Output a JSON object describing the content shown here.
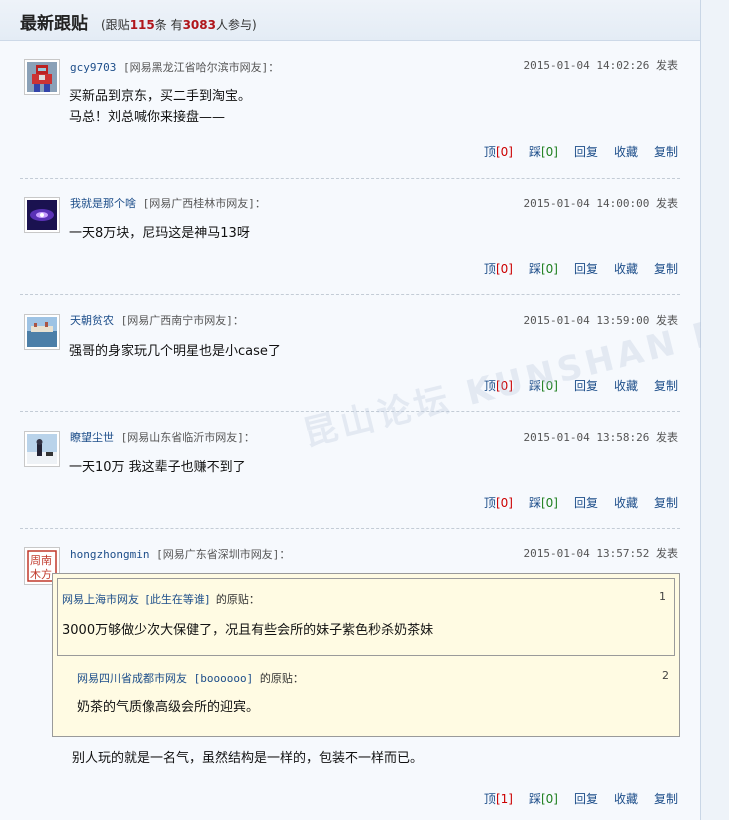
{
  "header": {
    "title": "最新跟贴",
    "stats_prefix": "(跟贴",
    "post_count": "115",
    "stats_mid": "条  有",
    "participants": "3083",
    "stats_suffix": "人参与)"
  },
  "watermark": "昆山论坛 KUNSHAN BBS",
  "posts": [
    {
      "user": "gcy9703",
      "location": "[网易黑龙江省哈尔滨市网友]：",
      "time": "2015-01-04 14:02:26 发表",
      "lines": [
        "买新品到京东，买二手到淘宝。",
        "马总！刘总喊你来接盘——"
      ],
      "avatar": "robot-avatar"
    },
    {
      "user": "我就是那个啥",
      "location": "[网易广西桂林市网友]：",
      "time": "2015-01-04 14:00:00 发表",
      "lines": [
        "一天8万块，尼玛这是神马13呀"
      ],
      "avatar": "galaxy-avatar"
    },
    {
      "user": "天朝贫农",
      "location": "[网易广西南宁市网友]：",
      "time": "2015-01-04 13:59:00 发表",
      "lines": [
        "强哥的身家玩几个明星也是小case了"
      ],
      "avatar": "harbor-avatar"
    },
    {
      "user": "瞭望尘世",
      "location": "[网易山东省临沂市网友]：",
      "time": "2015-01-04 13:58:26 发表",
      "lines": [
        "一天10万  我这辈子也赚不到了"
      ],
      "avatar": "snow-avatar"
    },
    {
      "user": "hongzhongmin",
      "location": "[网易广东省深圳市网友]：",
      "time": "2015-01-04 13:57:52 发表",
      "lines": [
        "别人玩的就是一名气，虽然结构是一样的，包装不一样而已。"
      ],
      "avatar": "seal-avatar",
      "avatar_text": "周南木方"
    }
  ],
  "actions": [
    {
      "up": "顶",
      "up_count": "[0]",
      "down": "踩",
      "down_count": "[0]",
      "reply": "回复",
      "fav": "收藏",
      "copy": "复制"
    },
    {
      "up": "顶",
      "up_count": "[0]",
      "down": "踩",
      "down_count": "[0]",
      "reply": "回复",
      "fav": "收藏",
      "copy": "复制"
    },
    {
      "up": "顶",
      "up_count": "[0]",
      "down": "踩",
      "down_count": "[0]",
      "reply": "回复",
      "fav": "收藏",
      "copy": "复制"
    },
    {
      "up": "顶",
      "up_count": "[0]",
      "down": "踩",
      "down_count": "[0]",
      "reply": "回复",
      "fav": "收藏",
      "copy": "复制"
    },
    {
      "up": "顶",
      "up_count": "[1]",
      "down": "踩",
      "down_count": "[0]",
      "reply": "回复",
      "fav": "收藏",
      "copy": "复制"
    }
  ],
  "quotes": [
    {
      "loc": "网易上海市网友",
      "user": "[此生在等谁]",
      "suffix": "的原贴：",
      "num": "1",
      "text": "3000万够做少次大保健了，况且有些会所的妹子紫色秒杀奶茶妹"
    },
    {
      "loc": "网易四川省成都市网友",
      "user": "[boooooo]",
      "suffix": "的原贴：",
      "num": "2",
      "text": "奶茶的气质像高级会所的迎宾。"
    }
  ],
  "colors": {
    "link": "#1d4e8a",
    "count_up": "#c00000",
    "count_down": "#208020",
    "quote_bg": "#fffbe3"
  }
}
